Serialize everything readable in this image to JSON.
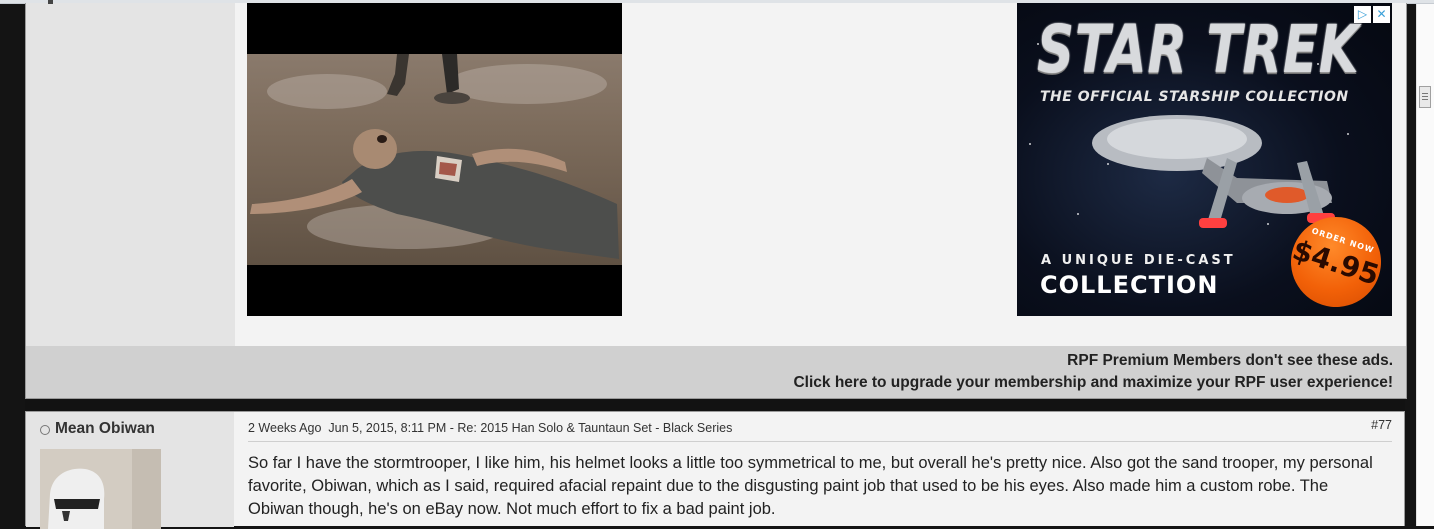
{
  "ad": {
    "title": "STAR TREK",
    "subtitle": "THE OFFICIAL STARSHIP COLLECTION",
    "line1": "A UNIQUE DIE-CAST",
    "line2": "COLLECTION",
    "badge_top": "ORDER NOW",
    "badge_price": "$4.95",
    "choices_icon": "adchoices-icon",
    "close_icon": "close-icon"
  },
  "premium": {
    "line1": "RPF Premium Members don't see these ads.",
    "line2": "Click here to upgrade your membership and maximize your RPF user experience!"
  },
  "post": {
    "username": "Mean Obiwan",
    "time_ago": "2 Weeks Ago",
    "datetime": "Jun 5, 2015, 8:11 PM",
    "thread": "Re: 2015 Han Solo & Tauntaun Set - Black Series",
    "number": "#77",
    "body": "So far I have the stormtrooper, I like him, his helmet looks a little too symmetrical to me, but overall he's pretty nice. Also got the sand trooper, my personal favorite, Obiwan, which as I said, required afacial repaint due to the disgusting paint job that used to be his eyes. Also made him a custom robe. The Obiwan though, he's on eBay now. Not much effort to fix a bad paint job."
  }
}
